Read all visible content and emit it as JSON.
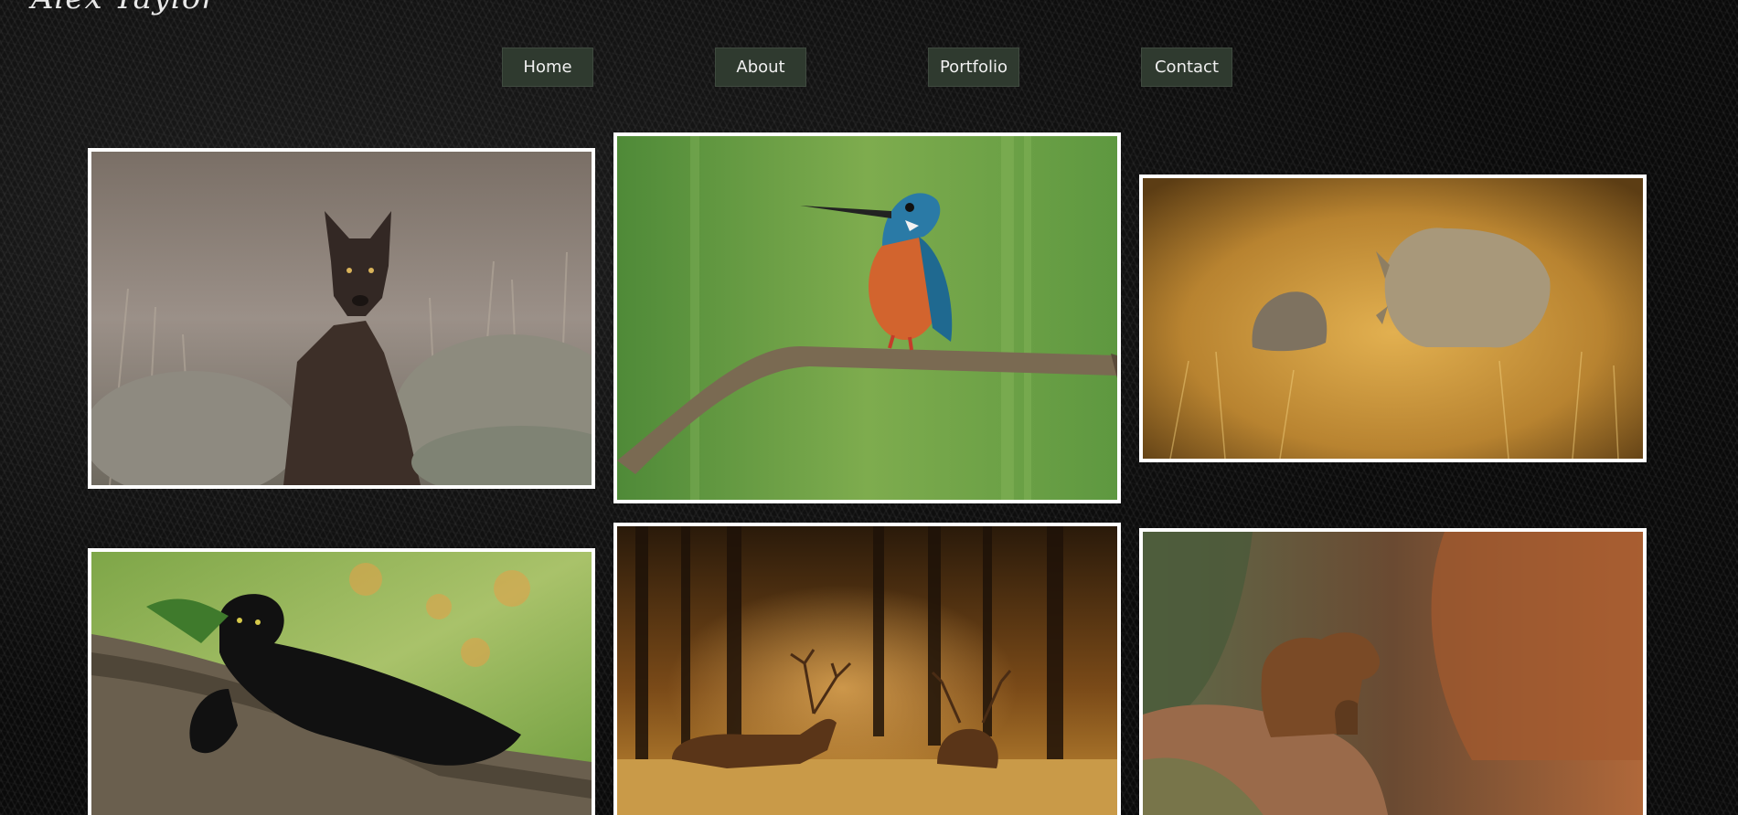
{
  "site": {
    "logo_text": "Alex Taylor"
  },
  "nav": {
    "items": [
      {
        "label": "Home"
      },
      {
        "label": "About"
      },
      {
        "label": "Portfolio"
      },
      {
        "label": "Contact"
      }
    ]
  },
  "gallery": {
    "photos": [
      {
        "subject": "wolf"
      },
      {
        "subject": "kingfisher"
      },
      {
        "subject": "rhinos"
      },
      {
        "subject": "black panther"
      },
      {
        "subject": "elk"
      },
      {
        "subject": "bears"
      }
    ]
  },
  "colors": {
    "nav_button_bg": "#2f3a2f",
    "photo_frame": "#ffffff",
    "background": "#0b0b0b"
  }
}
